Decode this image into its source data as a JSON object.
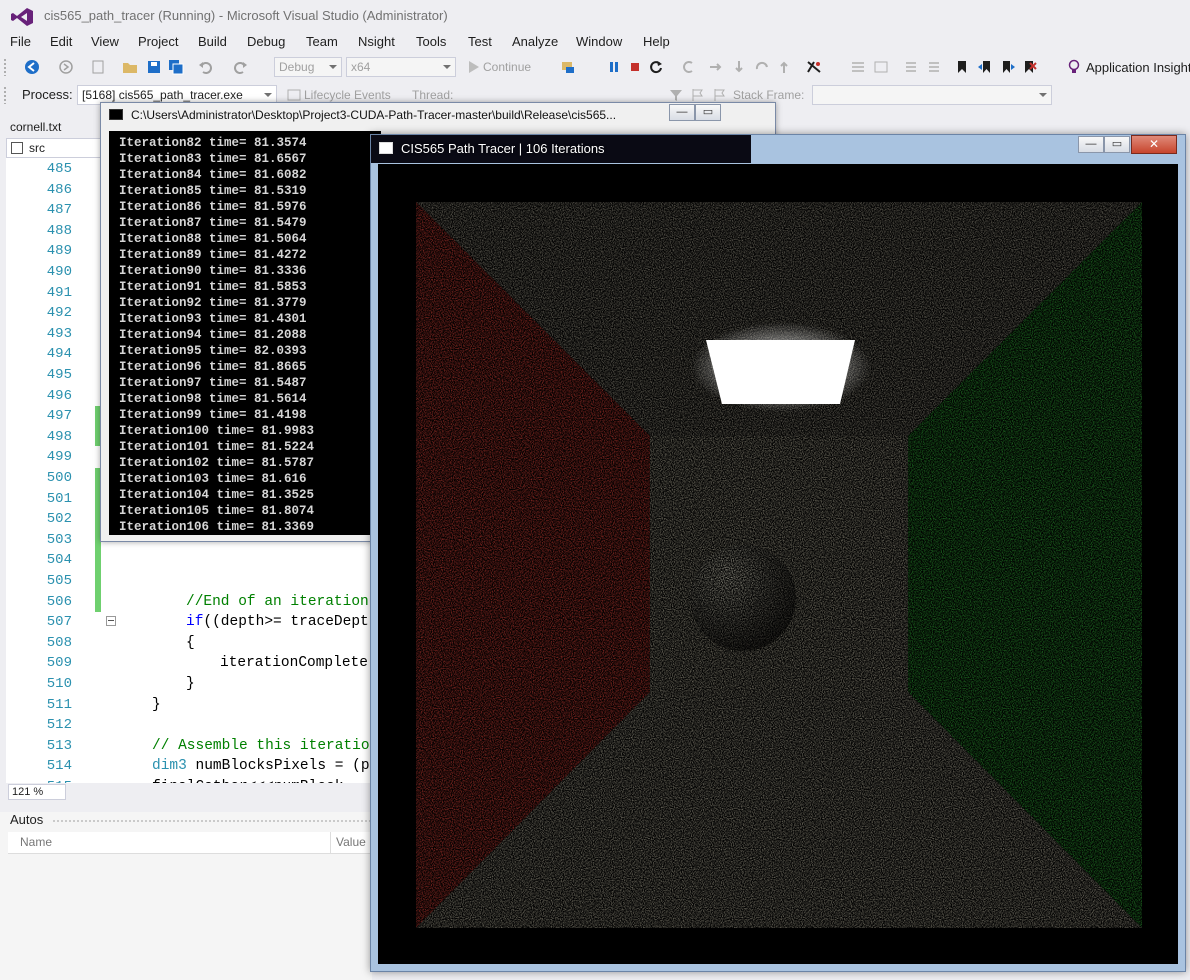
{
  "vs": {
    "title": "cis565_path_tracer (Running) - Microsoft Visual Studio (Administrator)",
    "menu": [
      "File",
      "Edit",
      "View",
      "Project",
      "Build",
      "Debug",
      "Team",
      "Nsight",
      "Tools",
      "Test",
      "Analyze",
      "Window",
      "Help"
    ],
    "toolbar": {
      "config": "Debug",
      "platform": "x64",
      "continue_label": "Continue",
      "app_insights_label": "Application Insights"
    },
    "debug_location": {
      "process_label": "Process:",
      "process_value": "[5168] cis565_path_tracer.exe",
      "lifecycle_label": "Lifecycle Events",
      "thread_label": "Thread:",
      "stack_label": "Stack Frame:"
    }
  },
  "editor": {
    "tab": "cornell.txt",
    "nav_scope": "src",
    "zoom": "121 %",
    "lines": [
      {
        "n": "485",
        "code": ""
      },
      {
        "n": "486",
        "code": ""
      },
      {
        "n": "487",
        "code": ""
      },
      {
        "n": "488",
        "code": ""
      },
      {
        "n": "489",
        "code": ""
      },
      {
        "n": "490",
        "code": ""
      },
      {
        "n": "491",
        "code": ""
      },
      {
        "n": "492",
        "code": ""
      },
      {
        "n": "493",
        "code": ""
      },
      {
        "n": "494",
        "code": ""
      },
      {
        "n": "495",
        "code": ""
      },
      {
        "n": "496",
        "code": ""
      },
      {
        "n": "497",
        "code": ""
      },
      {
        "n": "498",
        "code": ""
      },
      {
        "n": "499",
        "code": ""
      },
      {
        "n": "500",
        "code": ""
      },
      {
        "n": "501",
        "code": ""
      },
      {
        "n": "502",
        "code": ""
      },
      {
        "n": "503",
        "code": ""
      },
      {
        "n": "504",
        "code": ""
      },
      {
        "n": "505",
        "code": ""
      },
      {
        "n": "506",
        "code": "//End of an iteration"
      },
      {
        "n": "507",
        "code": "if((depth>= traceDept"
      },
      {
        "n": "508",
        "code": "{"
      },
      {
        "n": "509",
        "code": "iterationComplete"
      },
      {
        "n": "510",
        "code": "}"
      },
      {
        "n": "511",
        "code": "}"
      },
      {
        "n": "512",
        "code": ""
      },
      {
        "n": "513",
        "code": "// Assemble this iteratio"
      },
      {
        "n": "514",
        "code": "dim3 numBlocksPixels = (p"
      },
      {
        "n": "515",
        "code": "finalGather<<<numBlock"
      }
    ]
  },
  "autos": {
    "title": "Autos",
    "col_name": "Name",
    "col_value": "Value"
  },
  "console": {
    "title": "C:\\Users\\Administrator\\Desktop\\Project3-CUDA-Path-Tracer-master\\build\\Release\\cis565...",
    "lines": [
      "Iteration82 time= 81.3574",
      "Iteration83 time= 81.6567",
      "Iteration84 time= 81.6082",
      "Iteration85 time= 81.5319",
      "Iteration86 time= 81.5976",
      "Iteration87 time= 81.5479",
      "Iteration88 time= 81.5064",
      "Iteration89 time= 81.4272",
      "Iteration90 time= 81.3336",
      "Iteration91 time= 81.5853",
      "Iteration92 time= 81.3779",
      "Iteration93 time= 81.4301",
      "Iteration94 time= 81.2088",
      "Iteration95 time= 82.0393",
      "Iteration96 time= 81.8665",
      "Iteration97 time= 81.5487",
      "Iteration98 time= 81.5614",
      "Iteration99 time= 81.4198",
      "Iteration100 time= 81.9983",
      "Iteration101 time= 81.5224",
      "Iteration102 time= 81.5787",
      "Iteration103 time= 81.616",
      "Iteration104 time= 81.3525",
      "Iteration105 time= 81.8074",
      "Iteration106 time= 81.3369"
    ]
  },
  "tracer": {
    "title": "CIS565 Path Tracer | 106 Iterations",
    "colors": {
      "left_wall": "#8a2a24",
      "right_wall": "#1f6a22",
      "back_wall": "#6e6b5e",
      "floor": "#6c695d",
      "ceiling": "#5f5c52",
      "light": "#ffffff"
    }
  }
}
